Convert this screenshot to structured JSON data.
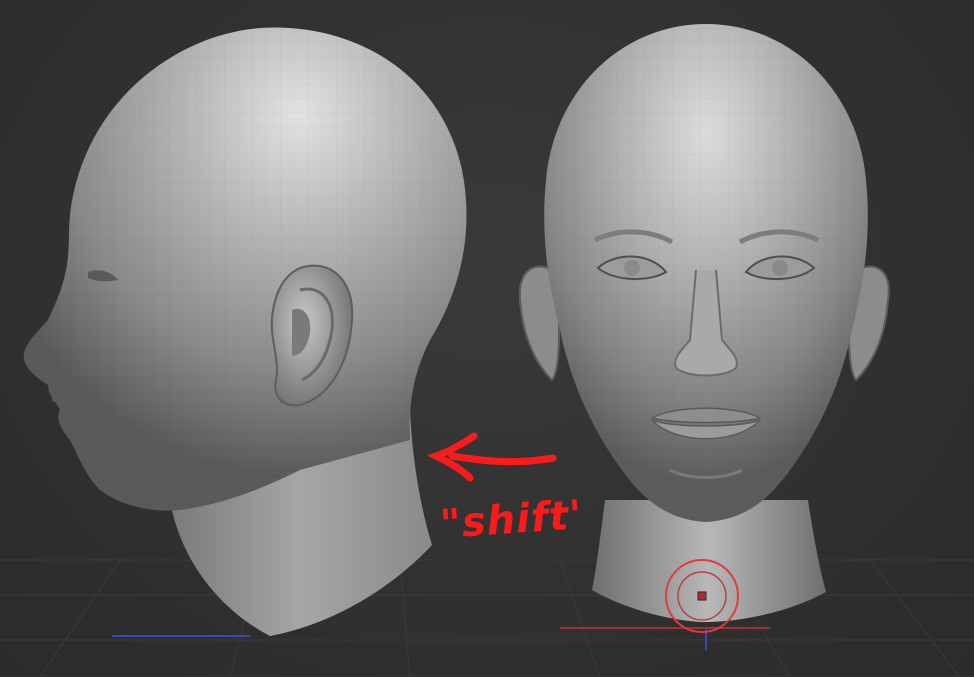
{
  "viewport": {
    "background": "#303030",
    "model_color": "#8e8e8e",
    "annotation_color": "#ff1a1a",
    "gizmo_color": "#e23a3a"
  },
  "annotation": {
    "label": "\"shift'",
    "arrow_direction": "left"
  },
  "views": {
    "left": "head-side-view",
    "right": "head-front-view"
  }
}
